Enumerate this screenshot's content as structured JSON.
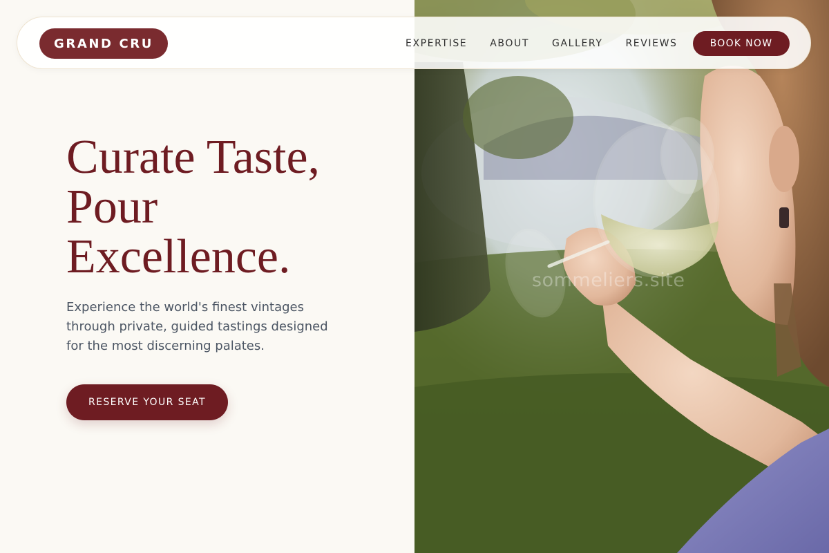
{
  "brand": {
    "logo_label": "GRAND CRU",
    "primary_color": "#6e1c22",
    "logo_color": "#7a2b2f"
  },
  "nav": {
    "links": [
      "EXPERTISE",
      "ABOUT",
      "GALLERY",
      "REVIEWS"
    ],
    "book_label": "BOOK NOW"
  },
  "hero": {
    "title_lines": [
      "Curate Taste,",
      "Pour",
      "Excellence."
    ],
    "text_lines": [
      "Experience the world's finest vintages",
      "through private, guided tastings designed",
      "for the most discerning palates."
    ],
    "cta_label": "RESERVE YOUR SEAT"
  },
  "photo": {
    "watermark": "sommeliers.site",
    "subject": "woman-drinking-white-wine-photo"
  }
}
